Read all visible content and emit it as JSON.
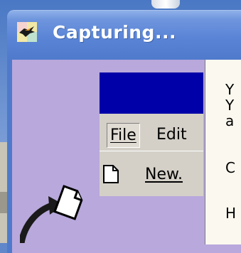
{
  "window": {
    "title": "Capturing..."
  },
  "inner_app": {
    "menu": {
      "file_label": "File",
      "edit_label": "Edit"
    },
    "dropdown": {
      "new_label": "New."
    }
  },
  "help_text": {
    "lines": [
      "Y",
      "Y",
      "a",
      "C",
      "H"
    ]
  },
  "icons": {
    "title_icon": "capture-app-icon",
    "arrow": "curved-arrow-icon",
    "document": "new-document-icon"
  }
}
